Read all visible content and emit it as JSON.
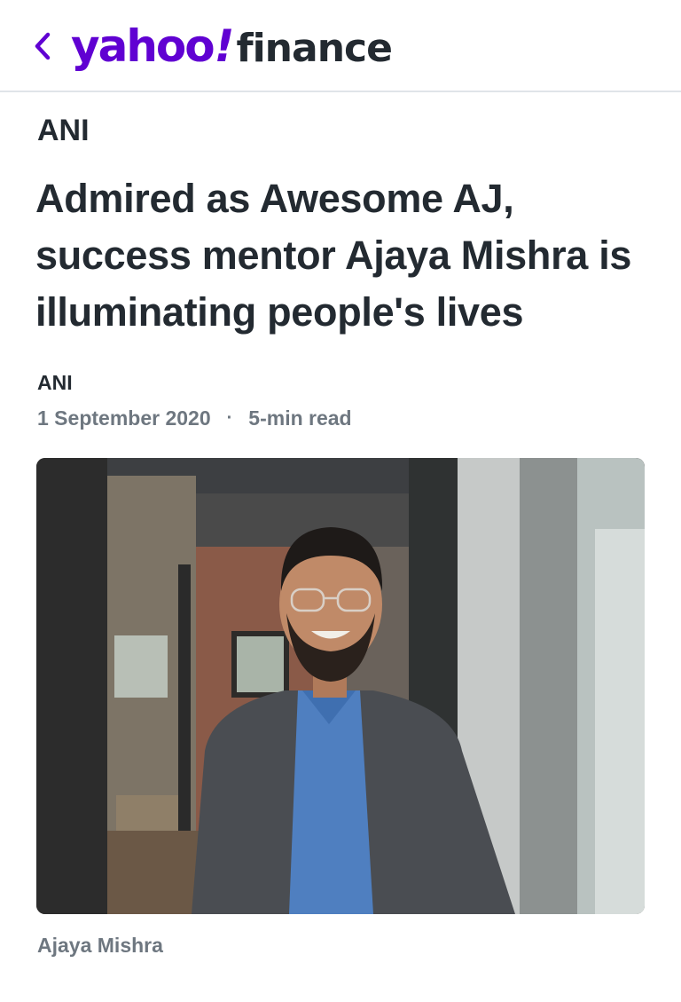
{
  "colors": {
    "brand": "#6001d2",
    "text": "#232a31",
    "muted": "#6e7780",
    "divider": "#e0e4e9"
  },
  "header": {
    "back_icon": "chevron-left-icon",
    "logo_yahoo": "yahoo",
    "logo_bang": "!",
    "logo_finance": "finance"
  },
  "article": {
    "publisher": "ANI",
    "title": "Admired as Awesome AJ, success mentor Ajaya Mishra is illuminating people's lives",
    "author": "ANI",
    "date": "1 September 2020",
    "separator": "·",
    "read_time": "5-min read",
    "image_caption": "Ajaya Mishra"
  }
}
